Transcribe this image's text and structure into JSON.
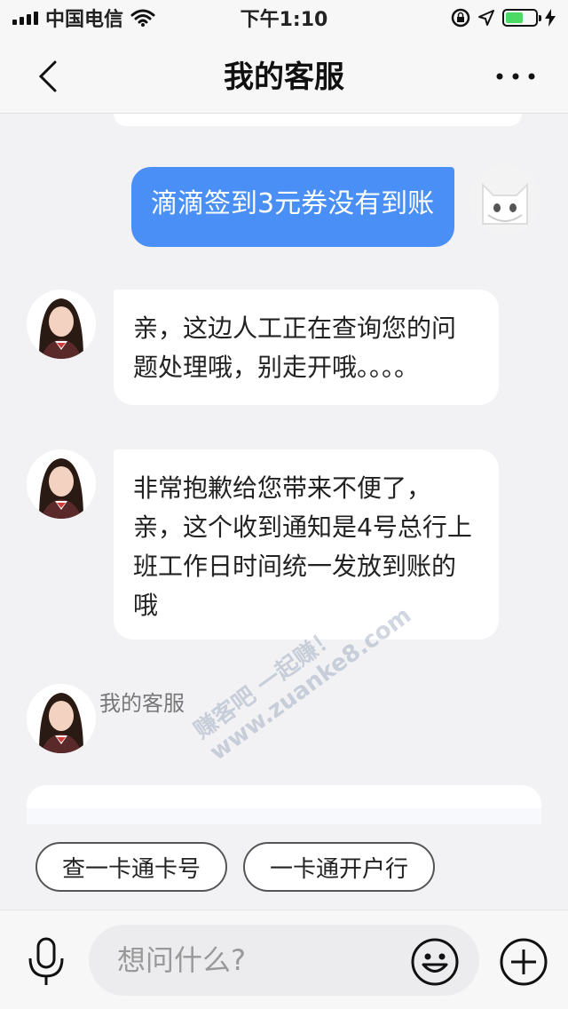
{
  "status_bar": {
    "carrier": "中国电信",
    "time": "下午1:10",
    "battery_level": 0.6,
    "icons": [
      "signal-icon",
      "wifi-icon",
      "rotation-lock-icon",
      "location-icon",
      "battery-icon",
      "charging-icon"
    ]
  },
  "nav": {
    "title": "我的客服",
    "back_icon": "chevron-left-icon",
    "more_icon": "ellipsis-icon"
  },
  "messages": [
    {
      "side": "right",
      "text": "滴滴签到3元券没有到账"
    },
    {
      "side": "left",
      "text": "亲，这边人工正在查询您的问题处理哦，别走开哦。。。。"
    },
    {
      "side": "left",
      "text": "非常抱歉给您带来不便了，亲，这个收到通知是4号总行上班工作日时间统一发放到账的哦"
    }
  ],
  "last_sender_name": "我的客服",
  "watermark_text": [
    "赚客吧 一起赚！",
    "www.zuanke8.com"
  ],
  "quick_replies": [
    "查一卡通卡号",
    "一卡通开户行"
  ],
  "input": {
    "placeholder": "想问什么?"
  },
  "colors": {
    "user_bubble": "#4a8ff5",
    "background": "#f2f2f4",
    "battery_green": "#4cd964"
  }
}
